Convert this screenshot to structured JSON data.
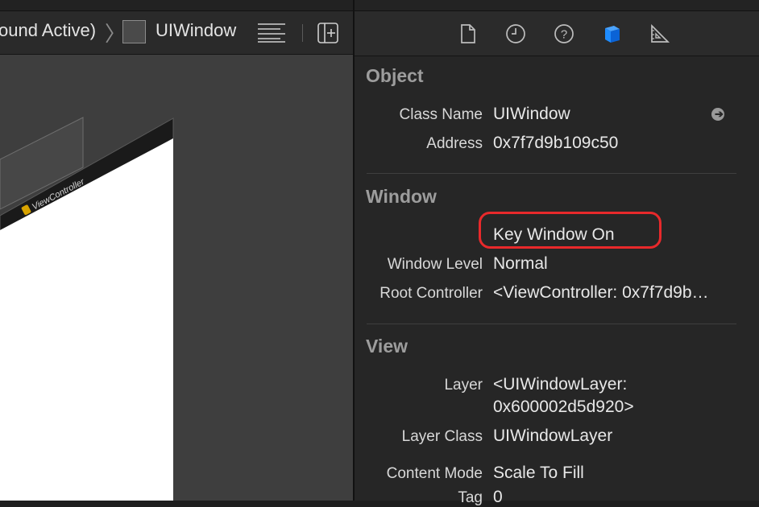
{
  "breadcrumb": {
    "prev_segment": "ound Active)",
    "current": "UIWindow"
  },
  "canvas": {
    "scene_label": "ViewController"
  },
  "inspector": {
    "tabs": [
      "file-icon",
      "history-icon",
      "help-icon",
      "object-inspector-icon",
      "size-inspector-icon"
    ],
    "active_tab_color": "#1e8cff",
    "sections": {
      "object": {
        "title": "Object",
        "class_name_label": "Class Name",
        "class_name_value": "UIWindow",
        "address_label": "Address",
        "address_value": "0x7f7d9b109c50"
      },
      "window": {
        "title": "Window",
        "key_window_value": "Key Window On",
        "window_level_label": "Window Level",
        "window_level_value": "Normal",
        "root_controller_label": "Root Controller",
        "root_controller_value": "<ViewController: 0x7f7d9b…"
      },
      "view": {
        "title": "View",
        "layer_label": "Layer",
        "layer_value_line1": "<UIWindowLayer:",
        "layer_value_line2": "0x600002d5d920>",
        "layer_class_label": "Layer Class",
        "layer_class_value": "UIWindowLayer",
        "content_mode_label": "Content Mode",
        "content_mode_value": "Scale To Fill",
        "tag_label": "Tag",
        "tag_value": "0"
      }
    }
  }
}
